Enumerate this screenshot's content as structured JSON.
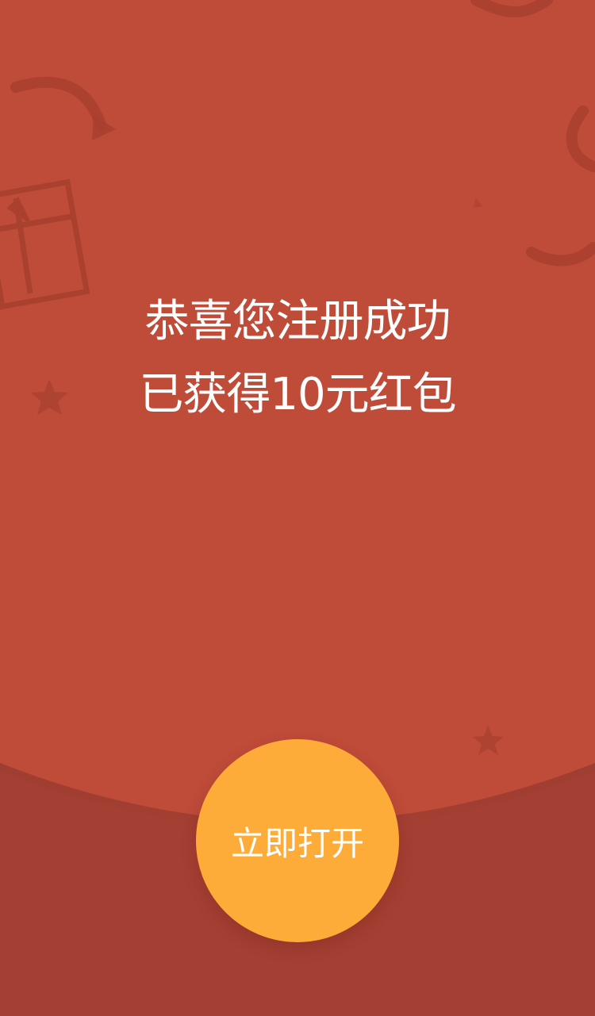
{
  "headline": {
    "line1": "恭喜您注册成功",
    "line2": "已获得10元红包"
  },
  "open_button": {
    "label": "立即打开"
  },
  "colors": {
    "background_upper": "#bf4b39",
    "background_lower": "#a33f33",
    "button": "#fdab39",
    "text": "#ffffff",
    "decor": "#a8402f"
  },
  "decorations": [
    "gift-box-icon",
    "ribbon-icon",
    "star-icon"
  ]
}
